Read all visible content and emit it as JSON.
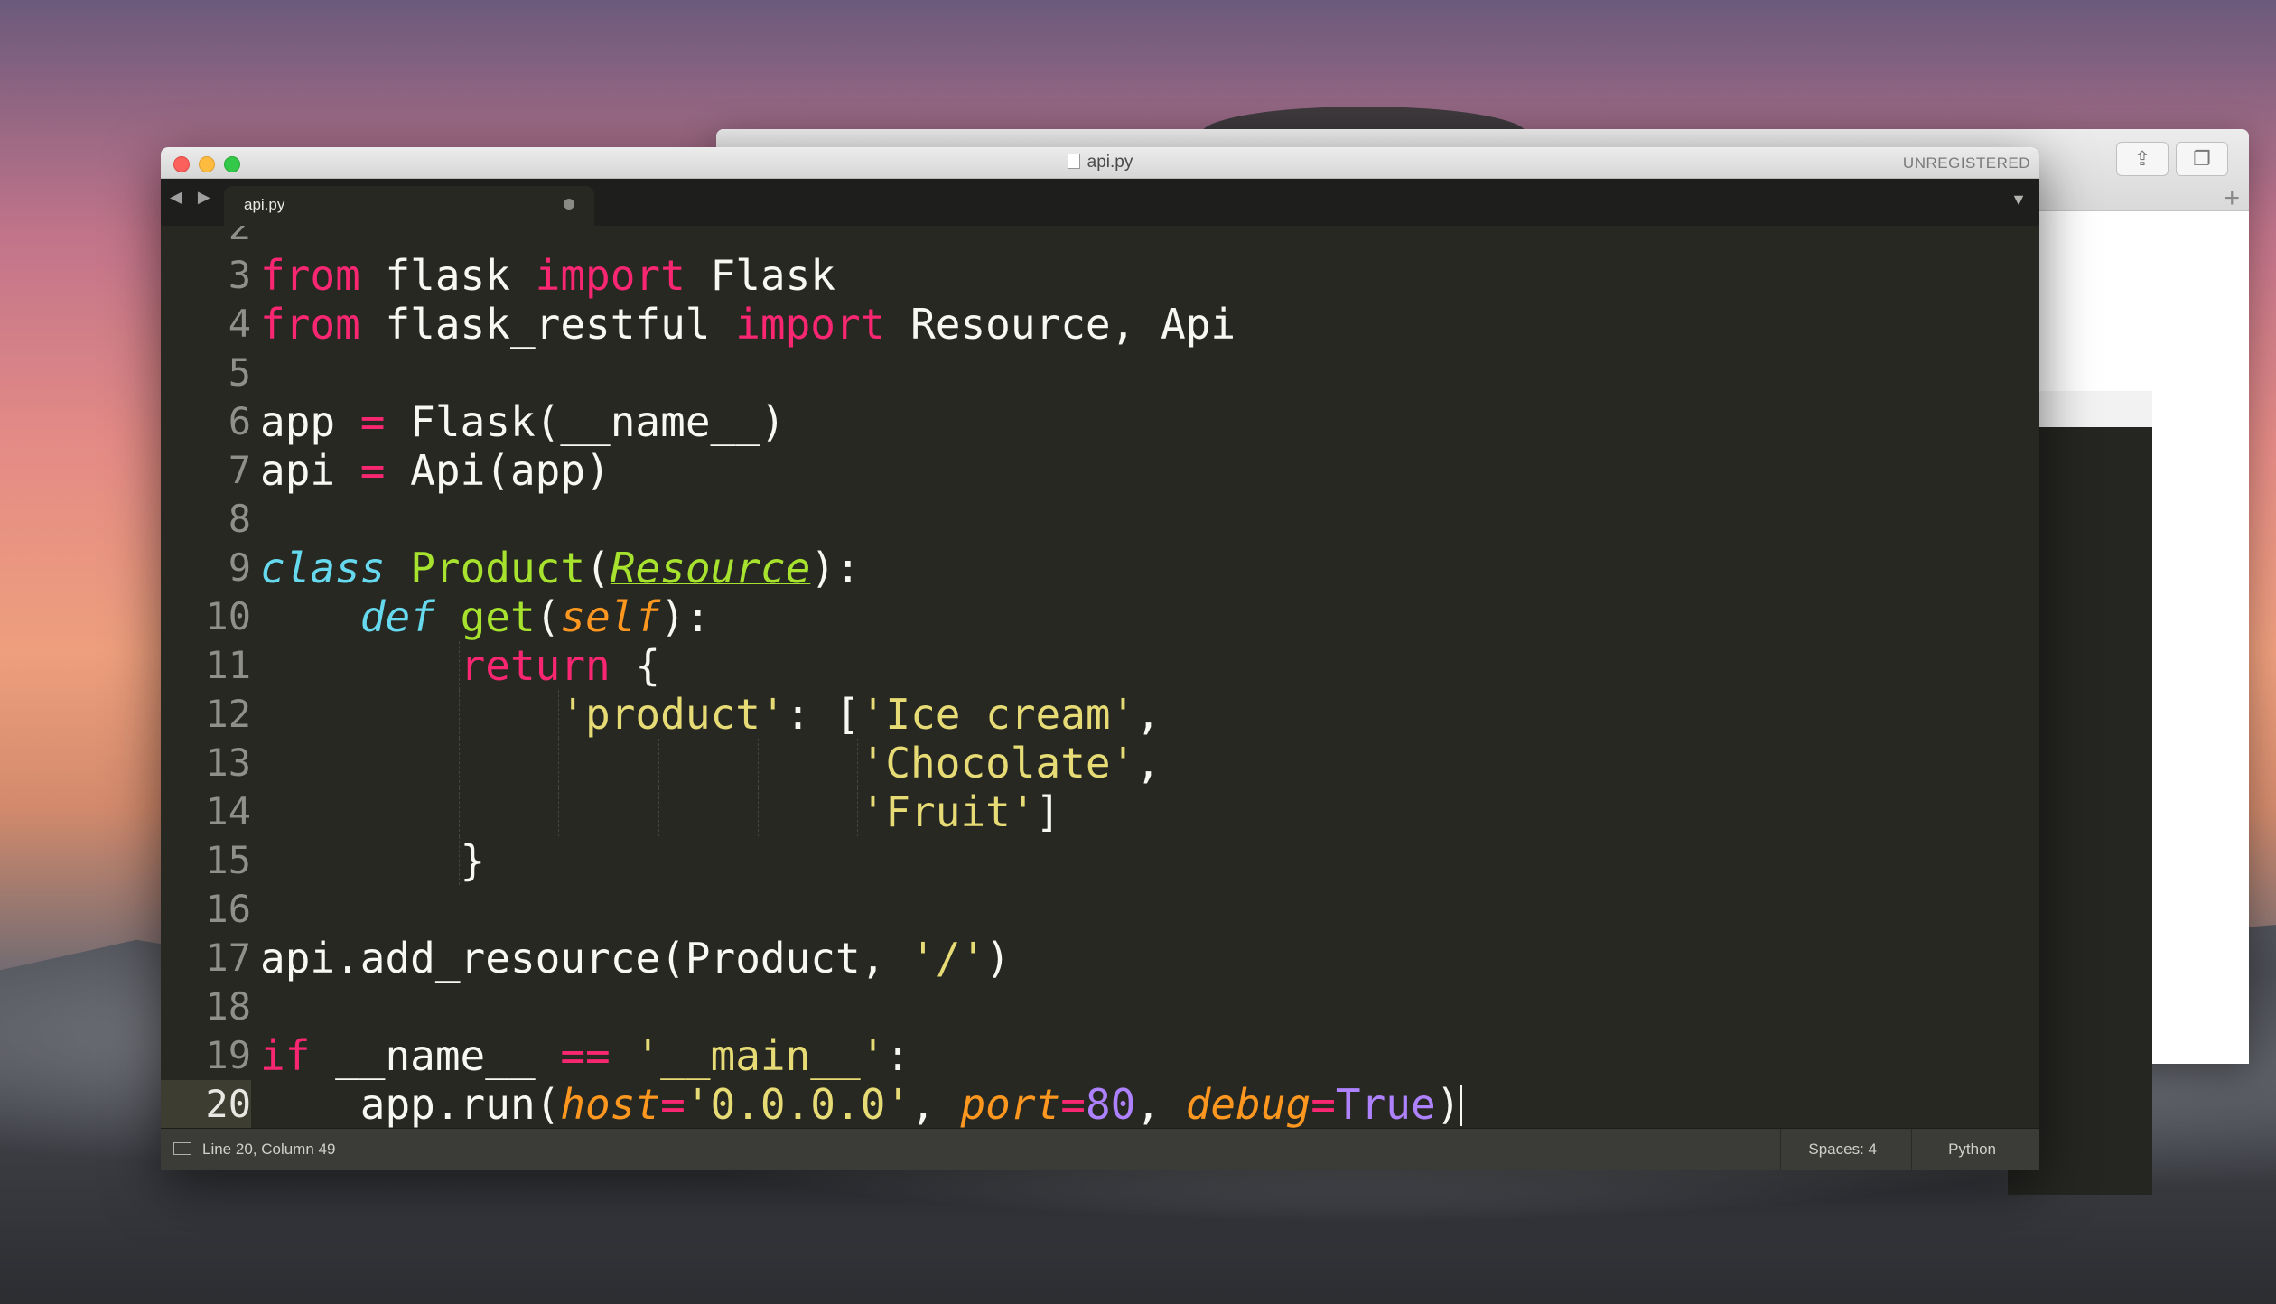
{
  "window": {
    "title": "api.py",
    "registration": "UNREGISTERED",
    "tab_label": "api.py",
    "nav_arrows": "◀ ▶",
    "tab_menu_glyph": "▼"
  },
  "code_lines": [
    {
      "num": "2",
      "current": false,
      "indent": 0,
      "tokens": []
    },
    {
      "num": "3",
      "current": false,
      "indent": 0,
      "tokens": [
        {
          "t": "from",
          "c": "kw"
        },
        {
          "t": " flask ",
          "c": ""
        },
        {
          "t": "import",
          "c": "kw"
        },
        {
          "t": " Flask",
          "c": ""
        }
      ]
    },
    {
      "num": "4",
      "current": false,
      "indent": 0,
      "tokens": [
        {
          "t": "from",
          "c": "kw"
        },
        {
          "t": " flask_restful ",
          "c": ""
        },
        {
          "t": "import",
          "c": "kw"
        },
        {
          "t": " Resource, Api",
          "c": ""
        }
      ]
    },
    {
      "num": "5",
      "current": false,
      "indent": 0,
      "tokens": []
    },
    {
      "num": "6",
      "current": false,
      "indent": 0,
      "tokens": [
        {
          "t": "app ",
          "c": ""
        },
        {
          "t": "=",
          "c": "kw"
        },
        {
          "t": " Flask(__name__)",
          "c": ""
        }
      ]
    },
    {
      "num": "7",
      "current": false,
      "indent": 0,
      "tokens": [
        {
          "t": "api ",
          "c": ""
        },
        {
          "t": "=",
          "c": "kw"
        },
        {
          "t": " Api(app)",
          "c": ""
        }
      ]
    },
    {
      "num": "8",
      "current": false,
      "indent": 0,
      "tokens": []
    },
    {
      "num": "9",
      "current": false,
      "indent": 0,
      "tokens": [
        {
          "t": "class",
          "c": "sto"
        },
        {
          "t": " ",
          "c": ""
        },
        {
          "t": "Product",
          "c": "fn"
        },
        {
          "t": "(",
          "c": ""
        },
        {
          "t": "Resource",
          "c": "inh"
        },
        {
          "t": "):",
          "c": ""
        }
      ]
    },
    {
      "num": "10",
      "current": false,
      "indent": 1,
      "tokens": [
        {
          "t": "    ",
          "c": ""
        },
        {
          "t": "def",
          "c": "sto"
        },
        {
          "t": " ",
          "c": ""
        },
        {
          "t": "get",
          "c": "fn"
        },
        {
          "t": "(",
          "c": ""
        },
        {
          "t": "self",
          "c": "prm"
        },
        {
          "t": "):",
          "c": ""
        }
      ]
    },
    {
      "num": "11",
      "current": false,
      "indent": 2,
      "tokens": [
        {
          "t": "        ",
          "c": ""
        },
        {
          "t": "return",
          "c": "kw"
        },
        {
          "t": " {",
          "c": ""
        }
      ]
    },
    {
      "num": "12",
      "current": false,
      "indent": 3,
      "tokens": [
        {
          "t": "            ",
          "c": ""
        },
        {
          "t": "'product'",
          "c": "st"
        },
        {
          "t": ": [",
          "c": ""
        },
        {
          "t": "'Ice cream'",
          "c": "st"
        },
        {
          "t": ",",
          "c": ""
        }
      ]
    },
    {
      "num": "13",
      "current": false,
      "indent": 6,
      "tokens": [
        {
          "t": "                        ",
          "c": ""
        },
        {
          "t": "'Chocolate'",
          "c": "st"
        },
        {
          "t": ",",
          "c": ""
        }
      ]
    },
    {
      "num": "14",
      "current": false,
      "indent": 6,
      "tokens": [
        {
          "t": "                        ",
          "c": ""
        },
        {
          "t": "'Fruit'",
          "c": "st"
        },
        {
          "t": "]",
          "c": ""
        }
      ]
    },
    {
      "num": "15",
      "current": false,
      "indent": 2,
      "tokens": [
        {
          "t": "        }",
          "c": ""
        }
      ]
    },
    {
      "num": "16",
      "current": false,
      "indent": 0,
      "tokens": []
    },
    {
      "num": "17",
      "current": false,
      "indent": 0,
      "tokens": [
        {
          "t": "api.add_resource(Product, ",
          "c": ""
        },
        {
          "t": "'/'",
          "c": "st"
        },
        {
          "t": ")",
          "c": ""
        }
      ]
    },
    {
      "num": "18",
      "current": false,
      "indent": 0,
      "tokens": []
    },
    {
      "num": "19",
      "current": false,
      "indent": 0,
      "tokens": [
        {
          "t": "if",
          "c": "kw"
        },
        {
          "t": " __name__ ",
          "c": ""
        },
        {
          "t": "==",
          "c": "kw"
        },
        {
          "t": " ",
          "c": ""
        },
        {
          "t": "'__main__'",
          "c": "st"
        },
        {
          "t": ":",
          "c": ""
        }
      ]
    },
    {
      "num": "20",
      "current": true,
      "indent": 1,
      "tokens": [
        {
          "t": "    app.run(",
          "c": ""
        },
        {
          "t": "host",
          "c": "prm"
        },
        {
          "t": "=",
          "c": "kw"
        },
        {
          "t": "'0.0.0.0'",
          "c": "st"
        },
        {
          "t": ", ",
          "c": ""
        },
        {
          "t": "port",
          "c": "prm"
        },
        {
          "t": "=",
          "c": "kw"
        },
        {
          "t": "80",
          "c": "nu"
        },
        {
          "t": ", ",
          "c": ""
        },
        {
          "t": "debug",
          "c": "prm"
        },
        {
          "t": "=",
          "c": "kw"
        },
        {
          "t": "True",
          "c": "nu"
        },
        {
          "t": ")",
          "c": ""
        }
      ]
    }
  ],
  "status": {
    "position": "Line 20, Column 49",
    "indentation": "Spaces: 4",
    "syntax": "Python"
  },
  "colors": {
    "editor_bg": "#272822",
    "keyword": "#f92672",
    "string": "#e6db74",
    "number": "#ae81ff",
    "function": "#a6e22e",
    "storage": "#66d9ef",
    "parameter": "#fd971f"
  }
}
